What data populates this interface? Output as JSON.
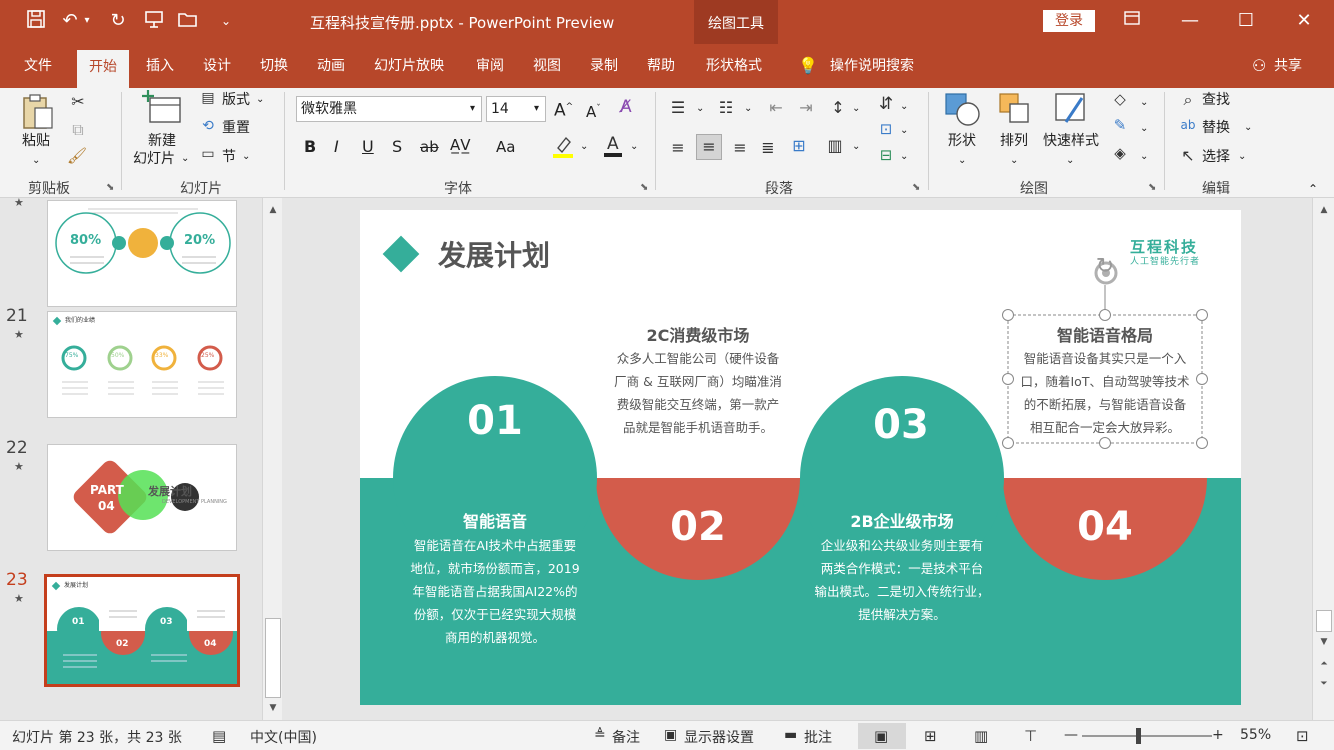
{
  "titlebar": {
    "title": "互程科技宣传册.pptx  -  PowerPoint Preview",
    "context_group": "绘图工具",
    "login": "登录",
    "colors": {
      "accent": "#b7472a"
    }
  },
  "tabs": [
    {
      "label": "文件"
    },
    {
      "label": "开始"
    },
    {
      "label": "插入"
    },
    {
      "label": "设计"
    },
    {
      "label": "切换"
    },
    {
      "label": "动画"
    },
    {
      "label": "幻灯片放映"
    },
    {
      "label": "审阅"
    },
    {
      "label": "视图"
    },
    {
      "label": "录制"
    },
    {
      "label": "帮助"
    },
    {
      "label": "形状格式"
    }
  ],
  "tell_me": "操作说明搜索",
  "share": "共享",
  "ribbon": {
    "clipboard": {
      "paste": "粘贴",
      "label": "剪贴板"
    },
    "slides": {
      "new_slide_1": "新建",
      "new_slide_2": "幻灯片",
      "layout": "版式",
      "reset": "重置",
      "section": "节",
      "label": "幻灯片"
    },
    "font": {
      "name": "微软雅黑",
      "size": "14",
      "label": "字体"
    },
    "paragraph": {
      "label": "段落"
    },
    "drawing": {
      "shapes": "形状",
      "arrange": "排列",
      "quick_styles": "快速样式",
      "label": "绘图"
    },
    "editing": {
      "find": "查找",
      "replace": "替换",
      "select": "选择",
      "label": "编辑"
    }
  },
  "thumbnails": [
    {
      "num": "",
      "p1": "80%",
      "p2": "20%"
    },
    {
      "num": "21",
      "title": "我们的业绩",
      "pcts": [
        "75%",
        "50%",
        "33%",
        "25%"
      ]
    },
    {
      "num": "22",
      "part": "PART",
      "part_num": "04",
      "heading": "发展计划",
      "sub": "DEVELOPMENT PLANNING"
    },
    {
      "num": "23",
      "title": "发展计划",
      "nums": [
        "01",
        "02",
        "03",
        "04"
      ]
    }
  ],
  "slide": {
    "title": "发展计划",
    "logo_name": "互程科技",
    "logo_tagline": "人工智能先行者",
    "colors": {
      "teal": "#35ae9a",
      "red": "#d35c4b"
    },
    "items": [
      {
        "num": "01",
        "heading": "智能语音",
        "body_lines": [
          "智能语音在AI技术中占据重要",
          "地位，就市场份额而言，2019",
          "年智能语音占据我国AI22%的",
          "份额，仅次于已经实现大规模",
          "商用的机器视觉。"
        ]
      },
      {
        "num": "02",
        "heading": "2C消费级市场",
        "body_lines": [
          "众多人工智能公司（硬件设备",
          "厂商 & 互联网厂商）均瞄准消",
          "费级智能交互终端，第一款产",
          "品就是智能手机语音助手。"
        ]
      },
      {
        "num": "03",
        "heading": "2B企业级市场",
        "body_lines": [
          "企业级和公共级业务则主要有",
          "两类合作模式：一是技术平台",
          "输出模式。二是切入传统行业，",
          "提供解决方案。"
        ]
      },
      {
        "num": "04",
        "heading": "智能语音格局",
        "body_lines": [
          "智能语音设备其实只是一个入",
          "口，随着IoT、自动驾驶等技术",
          "的不断拓展，与智能语音设备",
          "相互配合一定会大放异彩。"
        ]
      }
    ]
  },
  "statusbar": {
    "slide_info": "幻灯片 第 23 张，共 23 张",
    "language": "中文(中国)",
    "notes": "备注",
    "display": "显示器设置",
    "comments": "批注",
    "zoom": "55%"
  }
}
